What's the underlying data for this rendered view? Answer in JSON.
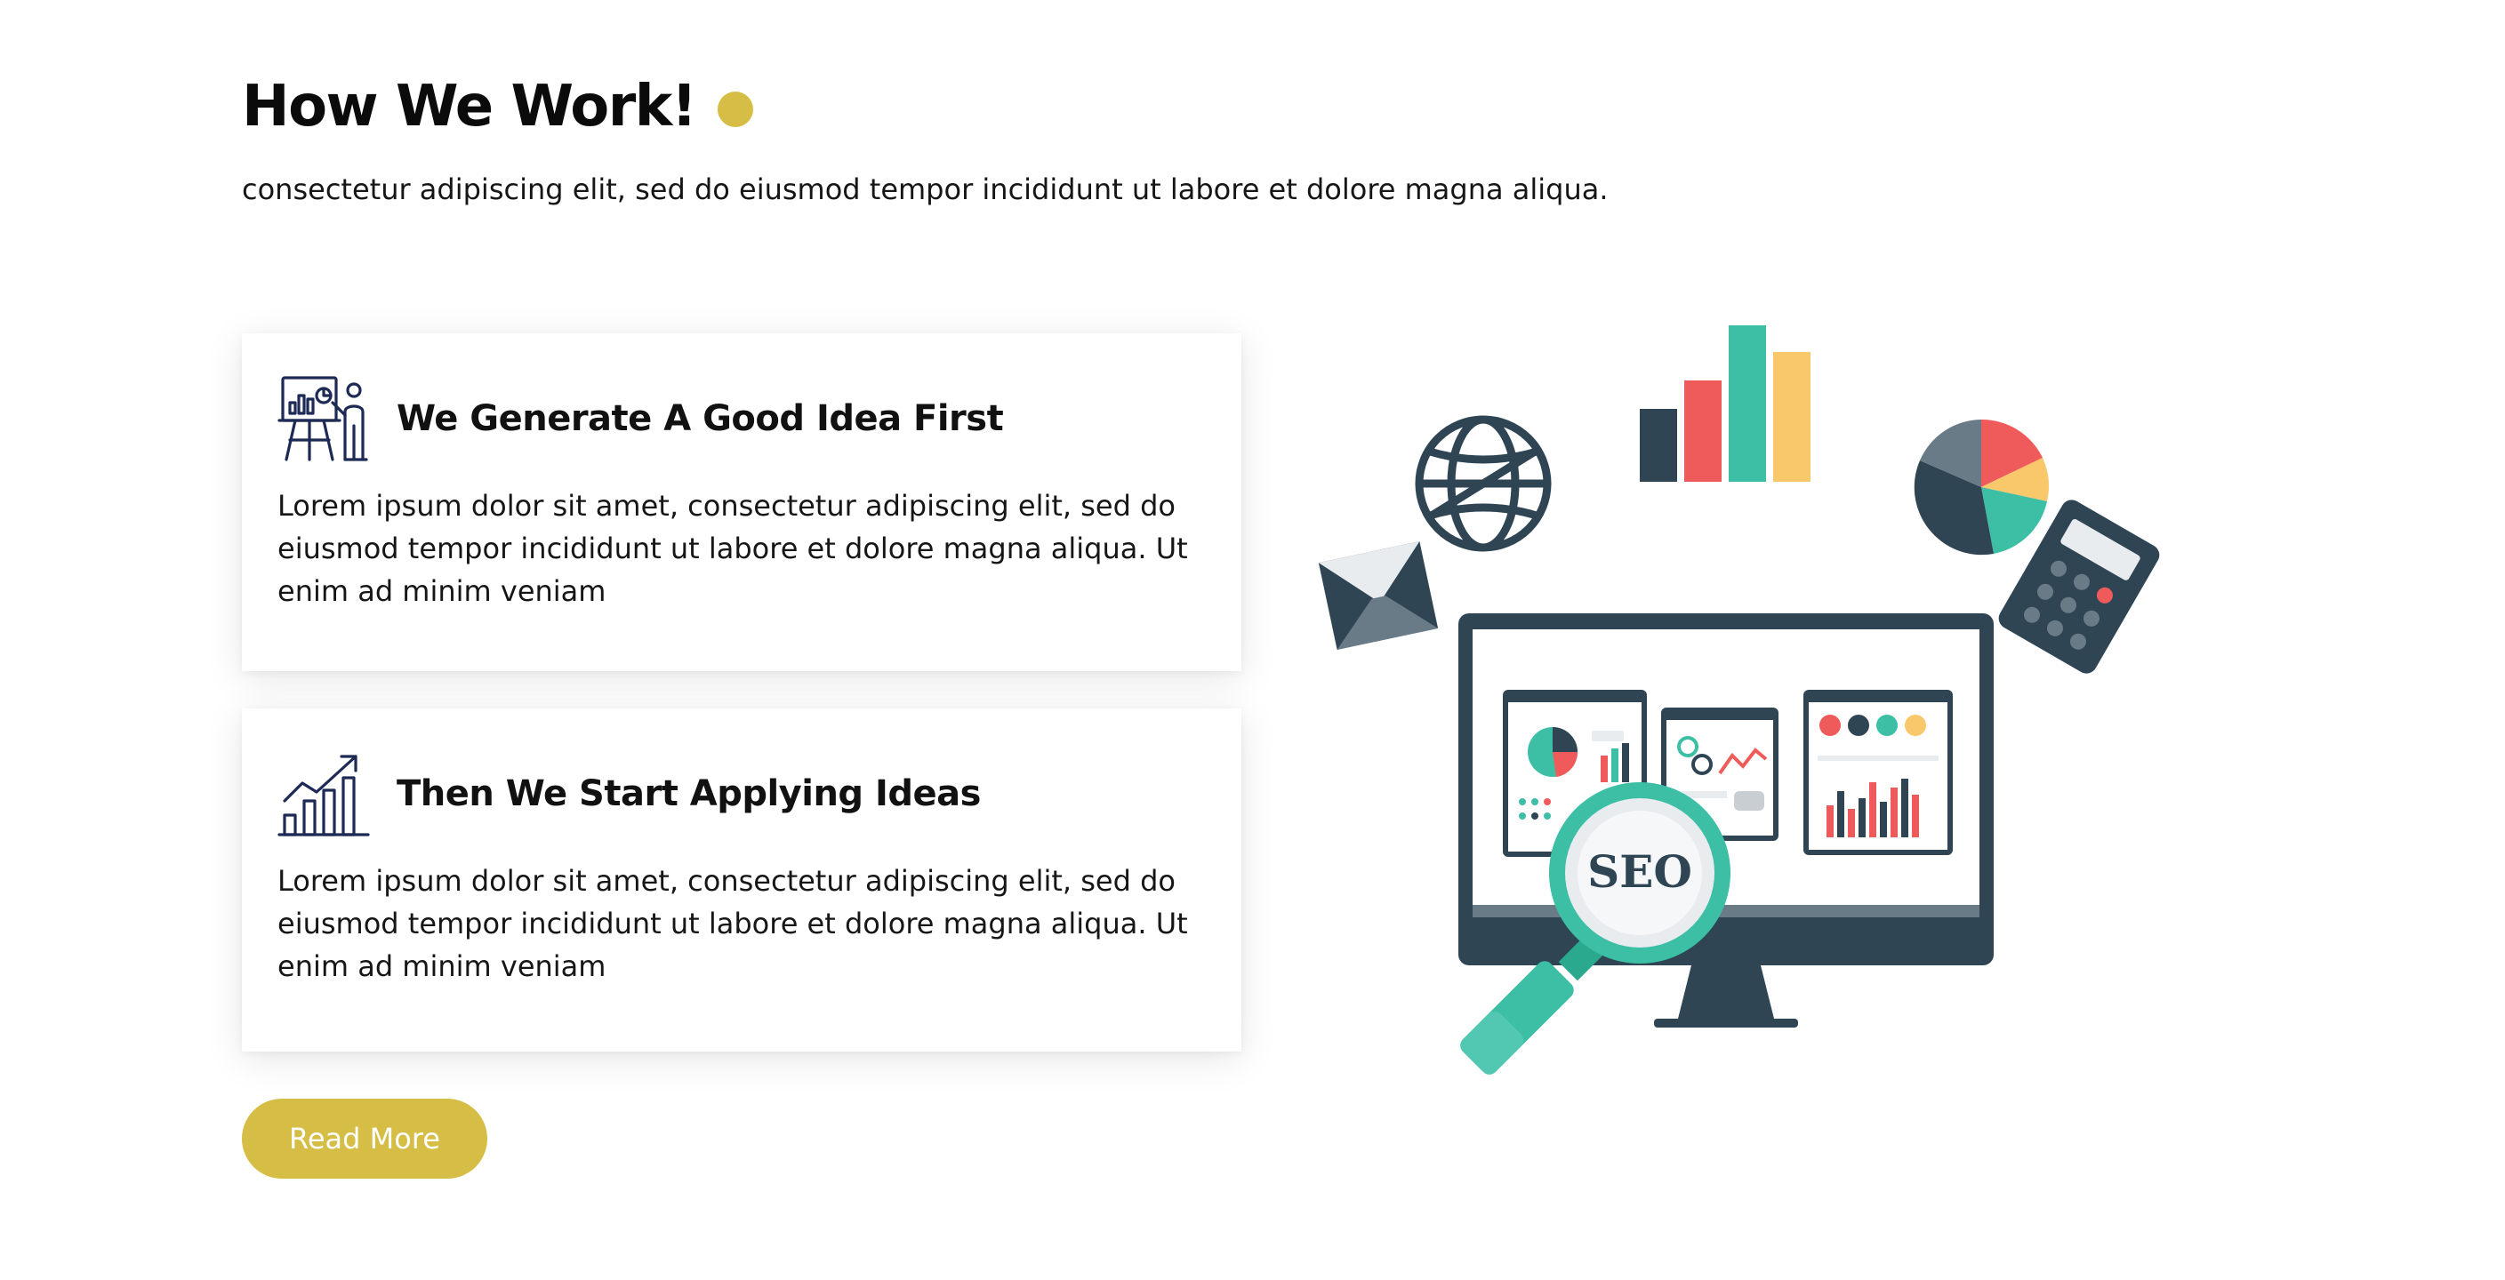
{
  "section": {
    "title": "How We Work!",
    "subtitle": "consectetur adipiscing elit, sed do eiusmod tempor incididunt ut labore et dolore magna aliqua.",
    "accent_color": "#d6bd45"
  },
  "cards": [
    {
      "icon": "presentation-board-icon",
      "title": "We Generate A Good Idea First",
      "text": "Lorem ipsum dolor sit amet, consectetur adipiscing elit, sed do eiusmod tempor incididunt ut labore et dolore magna aliqua. Ut enim ad minim veniam"
    },
    {
      "icon": "growth-chart-icon",
      "title": "Then We Start Applying Ideas",
      "text": "Lorem ipsum dolor sit amet, consectetur adipiscing elit, sed do eiusmod tempor incididunt ut labore et dolore magna aliqua. Ut enim ad minim veniam"
    }
  ],
  "button": {
    "label": "Read More"
  },
  "illustration": {
    "badge_text": "SEO",
    "colors": {
      "navy": "#2f4554",
      "teal": "#3dbfa6",
      "red": "#ef5b5b",
      "yellow": "#f9c86a",
      "grey": "#e9ecef"
    }
  }
}
